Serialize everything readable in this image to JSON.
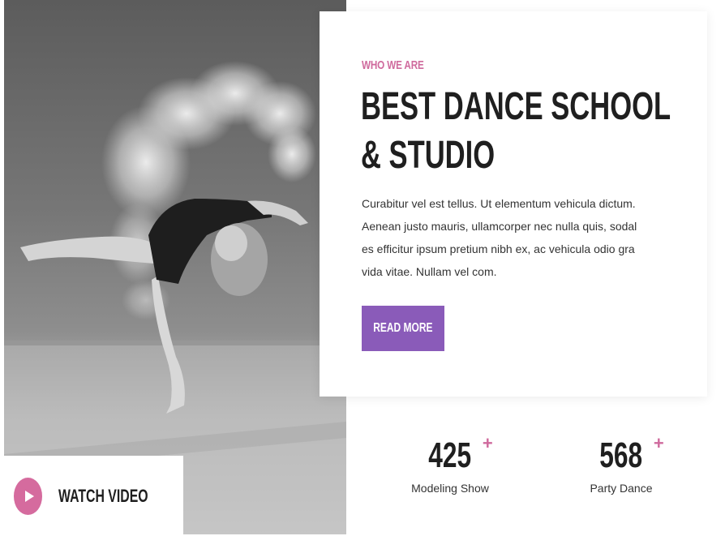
{
  "photo": {
    "alt": "Dancer in black leotard performing a backbend with a cloud of white powder"
  },
  "about": {
    "eyebrow": "WHO WE ARE",
    "title_line1": "BEST DANCE SCHOOL",
    "title_line2": "& STUDIO",
    "body": "Curabitur vel est tellus. Ut elementum vehicula dictum. Aenean justo mauris, ullamcorper nec nulla quis, sodal es efficitur ipsum pretium nibh ex, ac vehicula odio gra vida vitae. Nullam vel com.",
    "cta_label": "READ MORE"
  },
  "stats": [
    {
      "number": "425",
      "suffix": "+",
      "label": "Modeling Show"
    },
    {
      "number": "568",
      "suffix": "+",
      "label": "Party Dance"
    }
  ],
  "video": {
    "label": "WATCH VIDEO",
    "icon": "play-icon"
  },
  "colors": {
    "accent_pink": "#cf6a9d",
    "button_purple": "#8a5bb9",
    "heading": "#1f1f1f"
  }
}
